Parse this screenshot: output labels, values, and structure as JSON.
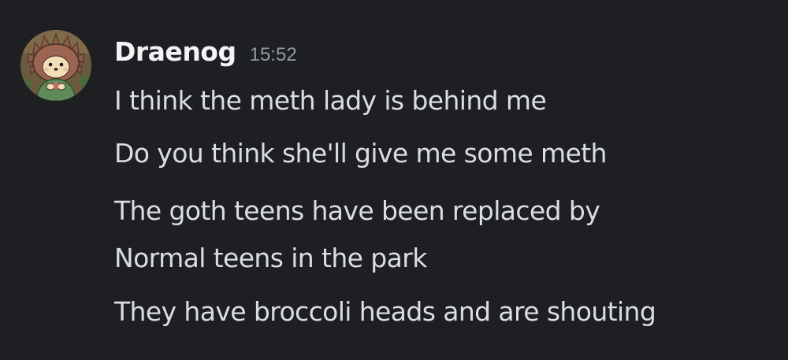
{
  "author": {
    "name": "Draenog",
    "timestamp": "15:52",
    "avatar_icon": "hedgehog-avatar-icon"
  },
  "messages": [
    "I think the meth lady is behind me",
    "Do you think she'll give me some meth",
    "The goth teens have been replaced by",
    "Normal teens in the park",
    "They have broccoli heads and are shouting"
  ],
  "colors": {
    "background": "#1e1f22",
    "username": "#f2f3f5",
    "timestamp": "#949ba4",
    "message_text": "#dbdee1"
  }
}
